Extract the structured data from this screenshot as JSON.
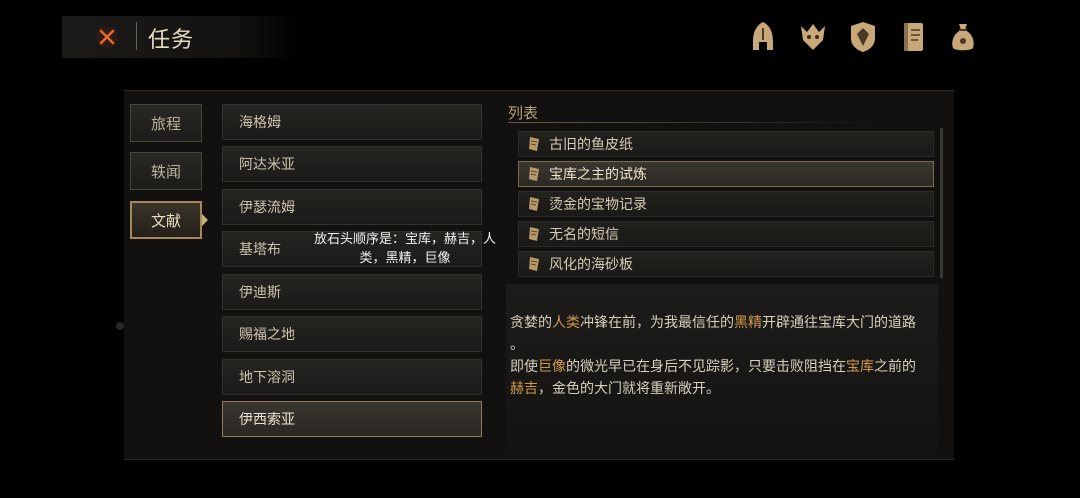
{
  "header": {
    "title": "任务",
    "close_icon": "close-icon",
    "icons": [
      "helmet-icon",
      "beast-sigil-icon",
      "shield-crest-icon",
      "journal-icon",
      "coin-bag-icon"
    ]
  },
  "categories": [
    {
      "label": "旅程",
      "active": false
    },
    {
      "label": "轶闻",
      "active": false
    },
    {
      "label": "文献",
      "active": true
    }
  ],
  "locations": [
    {
      "label": "海格姆"
    },
    {
      "label": "阿达米亚"
    },
    {
      "label": "伊瑟流姆"
    },
    {
      "label": "基塔布"
    },
    {
      "label": "伊迪斯"
    },
    {
      "label": "赐福之地"
    },
    {
      "label": "地下溶洞"
    },
    {
      "label": "伊西索亚",
      "selected": true
    }
  ],
  "list": {
    "title": "列表",
    "items": [
      {
        "label": "古旧的鱼皮纸"
      },
      {
        "label": "宝库之主的试炼",
        "selected": true
      },
      {
        "label": "烫金的宝物记录"
      },
      {
        "label": "无名的短信"
      },
      {
        "label": "风化的海砂板"
      }
    ]
  },
  "description": {
    "p1": {
      "a": "贪婪的",
      "b": "人类",
      "c": "冲锋在前，为我最信任的",
      "d": "黑精",
      "e": "开辟通往宝库大门的道路"
    },
    "p1_tail": "。",
    "p2": {
      "a": "即使",
      "b": "巨像",
      "c": "的微光早已在身后不见踪影，只要击败阻挡在",
      "d": "宝库",
      "e": "之前的"
    },
    "p3": {
      "a": "赫吉",
      "b": "，金色的大门就将重新敞开。"
    }
  },
  "overlay": {
    "line1": "放石头顺序是：宝库，赫吉，人",
    "line2": "类，黑精，巨像"
  },
  "colors": {
    "accent": "#a58856",
    "highlight": "#d09a4c",
    "background": "#000000"
  }
}
